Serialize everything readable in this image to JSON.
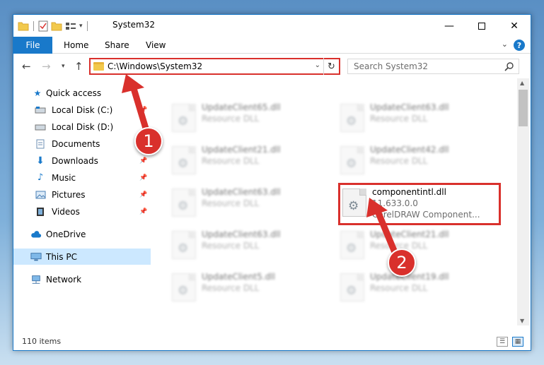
{
  "window": {
    "title": "System32"
  },
  "ribbon": {
    "file": "File",
    "tabs": [
      "Home",
      "Share",
      "View"
    ]
  },
  "address": {
    "path": "C:\\Windows\\System32"
  },
  "search": {
    "placeholder": "Search System32"
  },
  "sidebar": {
    "items": [
      {
        "label": "Quick access"
      },
      {
        "label": "Local Disk (C:)"
      },
      {
        "label": "Local Disk (D:)"
      },
      {
        "label": "Documents"
      },
      {
        "label": "Downloads"
      },
      {
        "label": "Music"
      },
      {
        "label": "Pictures"
      },
      {
        "label": "Videos"
      },
      {
        "label": "OneDrive"
      },
      {
        "label": "This PC"
      },
      {
        "label": "Network"
      }
    ]
  },
  "files": [
    {
      "name": "UpdateClient65.dll",
      "type": "Resource DLL"
    },
    {
      "name": "UpdateClient63.dll",
      "type": "Resource DLL"
    },
    {
      "name": "UpdateClient21.dll",
      "type": "Resource DLL"
    },
    {
      "name": "UpdateClient42.dll",
      "type": "Resource DLL"
    },
    {
      "name": "UpdateClient63.dll",
      "type": "Resource DLL"
    },
    {
      "name": "componentintl.dll",
      "version": "11.633.0.0",
      "description": "CorelDRAW Component..."
    },
    {
      "name": "UpdateClient63.dll",
      "type": "Resource DLL"
    },
    {
      "name": "UpdateClient21.dll",
      "type": "Resource DLL"
    },
    {
      "name": "UpdateClient5.dll",
      "type": "Resource DLL"
    },
    {
      "name": "UpdateClient19.dll",
      "type": "Resource DLL"
    }
  ],
  "status": {
    "items": "110 items"
  },
  "annotations": {
    "badge1": "1",
    "badge2": "2",
    "color": "#d9302c"
  },
  "colors": {
    "accent": "#1979ca",
    "selected": "#cce8ff"
  }
}
